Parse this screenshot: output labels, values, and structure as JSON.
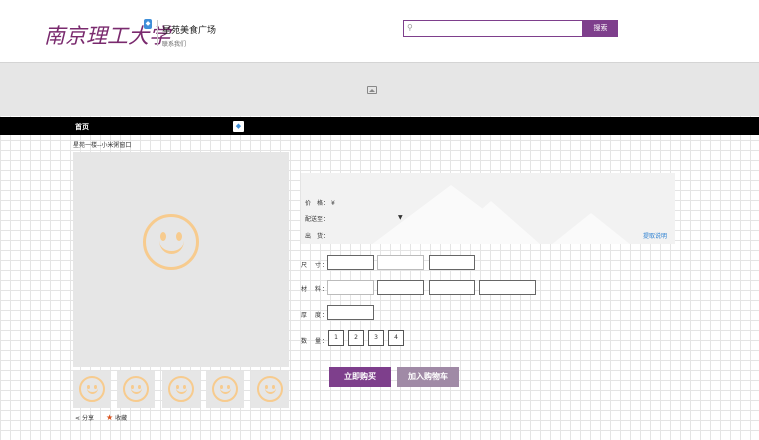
{
  "header": {
    "logo_text": "南京理工大学",
    "site_title": "星苑美食广场",
    "contact": "联系我们",
    "search_placeholder": "",
    "search_button": "搜索"
  },
  "nav": {
    "home": "首页"
  },
  "breadcrumb": "星苑一楼--小米粥窗口",
  "actions": {
    "share": "分享",
    "favorite": "收藏"
  },
  "info": {
    "price_label": "价　格：",
    "price_symbol": "¥",
    "delivery_label": "配送至：",
    "delivery_value": "",
    "merchant_label": "出　货：",
    "help_link": "提取说明"
  },
  "options": {
    "size_label": "尺　寸：",
    "material_label": "材　料：",
    "thickness_label": "厚　度：",
    "quantity_label": "数　量："
  },
  "quantities": [
    "1",
    "2",
    "3",
    "4"
  ],
  "buttons": {
    "buy": "立即购买",
    "cart": "加入购物车"
  },
  "colors": {
    "brand": "#7e3f8c",
    "cart": "#a08aa6",
    "logo": "#7a2a6e",
    "placeholder": "#f7cb8e"
  }
}
